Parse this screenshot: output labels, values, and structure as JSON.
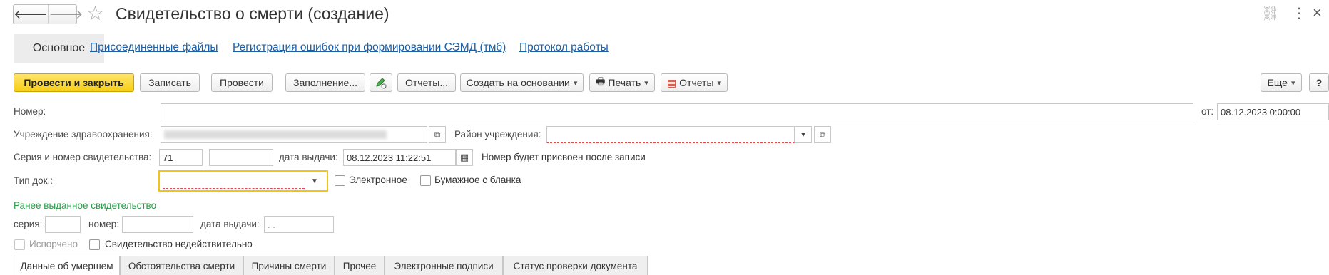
{
  "window": {
    "title": "Свидетельство о смерти (создание)"
  },
  "nav": {
    "back_icon": "arrow-left-icon",
    "forward_icon": "arrow-right-icon",
    "star_icon": "star-icon"
  },
  "top_tabs": [
    {
      "label": "Основное"
    },
    {
      "label": "Присоединенные файлы"
    },
    {
      "label": "Регистрация ошибок при формировании СЭМД (тмб)"
    },
    {
      "label": "Протокол работы"
    }
  ],
  "toolbar": {
    "post_close": "Провести и закрыть",
    "save": "Записать",
    "post": "Провести",
    "fill": "Заполнение...",
    "reports1": "Отчеты...",
    "create_based": "Создать на основании",
    "print": "Печать",
    "reports2": "Отчеты",
    "more": "Еще",
    "help": "?"
  },
  "form": {
    "number_label": "Номер:",
    "number_value": "",
    "from_label": "от:",
    "from_value": "08.12.2023  0:00:00",
    "institution_label": "Учреждение здравоохранения:",
    "district_label": "Район учреждения:",
    "district_value": "",
    "series_label": "Серия и номер свидетельства:",
    "series_value": "71",
    "number2_value": "",
    "issue_date_label": "дата выдачи:",
    "issue_date_value": "08.12.2023 11:22:51",
    "number_note": "Номер будет присвоен после записи",
    "doc_type_label": "Тип док.:",
    "doc_type_value": "",
    "electronic_label": "Электронное",
    "paper_label": "Бумажное с бланка"
  },
  "previous": {
    "header": "Ранее выданное свидетельство",
    "series_label": "серия:",
    "number_label": "номер:",
    "date_label": "дата выдачи:",
    "date_value": ". .",
    "spoiled_label": "Испорчено",
    "invalid_label": "Свидетельство недействительно"
  },
  "bottom_tabs": [
    {
      "label": "Данные об умершем"
    },
    {
      "label": "Обстоятельства смерти"
    },
    {
      "label": "Причины смерти"
    },
    {
      "label": "Прочее"
    },
    {
      "label": "Электронные подписи"
    },
    {
      "label": "Статус проверки документа"
    }
  ],
  "colors": {
    "accent": "#f6cf15",
    "link": "#1b5fa7",
    "green_header": "#2a9a4a",
    "required": "#e34a4a"
  }
}
